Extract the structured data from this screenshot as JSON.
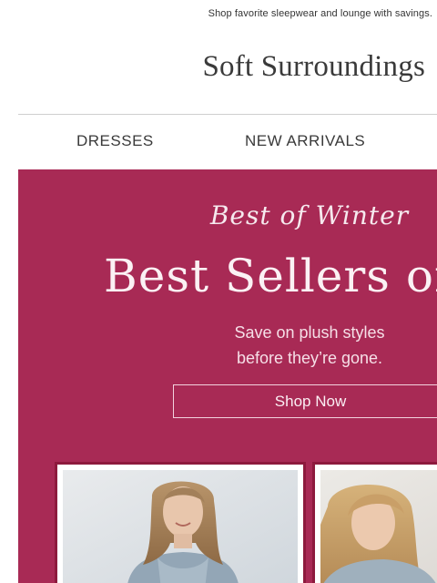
{
  "preheader": "Shop favorite sleepwear and lounge with savings.",
  "brand": {
    "logo_text": "Soft Surroundings"
  },
  "nav": {
    "items": [
      {
        "label": "DRESSES"
      },
      {
        "label": "NEW ARRIVALS"
      }
    ]
  },
  "hero": {
    "background_color": "#a82a55",
    "kicker": "Best of Winter",
    "headline": "Best Sellers on S",
    "subtext_line1": "Save on plush styles",
    "subtext_line2": "before they’re gone.",
    "cta_label": "Shop Now"
  },
  "products": [
    {
      "image_alt": "woman-in-gray-plush-robe-photo"
    },
    {
      "image_alt": "woman-in-gray-plush-top-photo"
    }
  ]
}
